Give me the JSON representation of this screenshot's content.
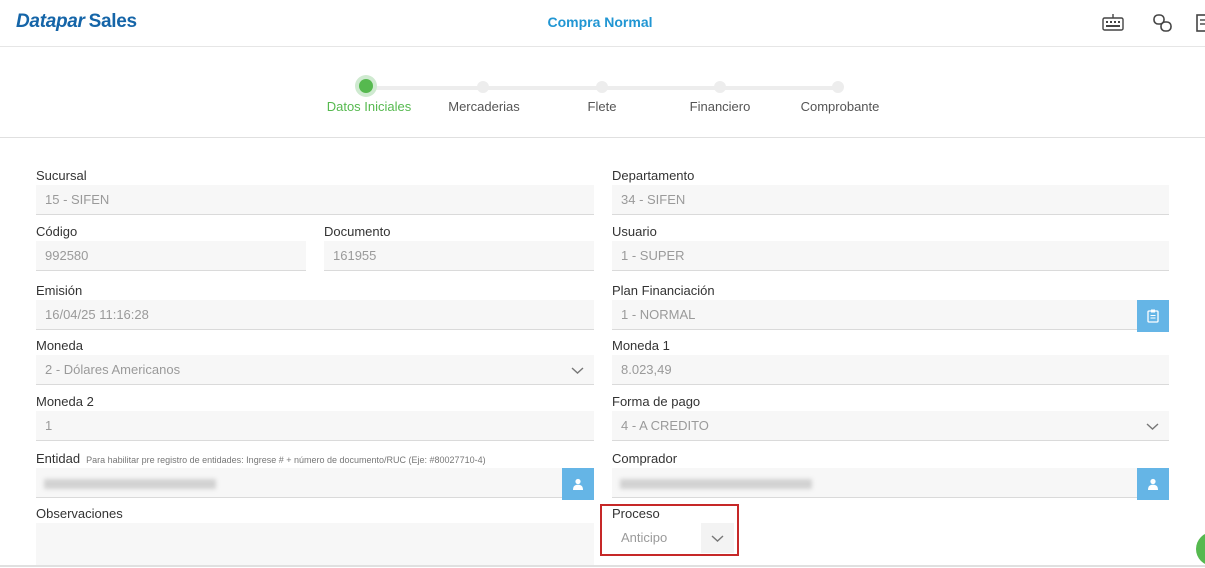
{
  "header": {
    "brand_part1": "Datapar",
    "brand_part2": "Sales",
    "title": "Compra Normal",
    "icons": [
      "keyboard-icon",
      "link-icon",
      "document-icon"
    ]
  },
  "steps": [
    {
      "label": "Datos Iniciales",
      "active": true
    },
    {
      "label": "Mercaderias",
      "active": false
    },
    {
      "label": "Flete",
      "active": false
    },
    {
      "label": "Financiero",
      "active": false
    },
    {
      "label": "Comprobante",
      "active": false
    }
  ],
  "form": {
    "sucursal": {
      "label": "Sucursal",
      "value": "15 - SIFEN"
    },
    "departamento": {
      "label": "Departamento",
      "value": "34 - SIFEN"
    },
    "codigo": {
      "label": "Código",
      "value": "992580"
    },
    "documento": {
      "label": "Documento",
      "value": "161955"
    },
    "usuario": {
      "label": "Usuario",
      "value": "1 - SUPER"
    },
    "emision": {
      "label": "Emisión",
      "value": "16/04/25 11:16:28"
    },
    "plan": {
      "label": "Plan Financiación",
      "value": "1 - NORMAL"
    },
    "moneda": {
      "label": "Moneda",
      "value": "2 - Dólares Americanos"
    },
    "moneda1": {
      "label": "Moneda 1",
      "value": "8.023,49"
    },
    "moneda2": {
      "label": "Moneda 2",
      "value": "1"
    },
    "forma_pago": {
      "label": "Forma de pago",
      "value": "4 - A CREDITO"
    },
    "entidad": {
      "label": "Entidad",
      "hint": "Para habilitar pre registro de entidades: Ingrese # + número de documento/RUC (Eje: #80027710-4)"
    },
    "comprador": {
      "label": "Comprador"
    },
    "observaciones": {
      "label": "Observaciones"
    },
    "proceso": {
      "label": "Proceso",
      "value": "Anticipo"
    }
  },
  "colors": {
    "brand": "#1565a8",
    "title": "#2196d3",
    "active_step": "#56b94f",
    "button": "#65b5e6",
    "highlight": "#c62828"
  }
}
